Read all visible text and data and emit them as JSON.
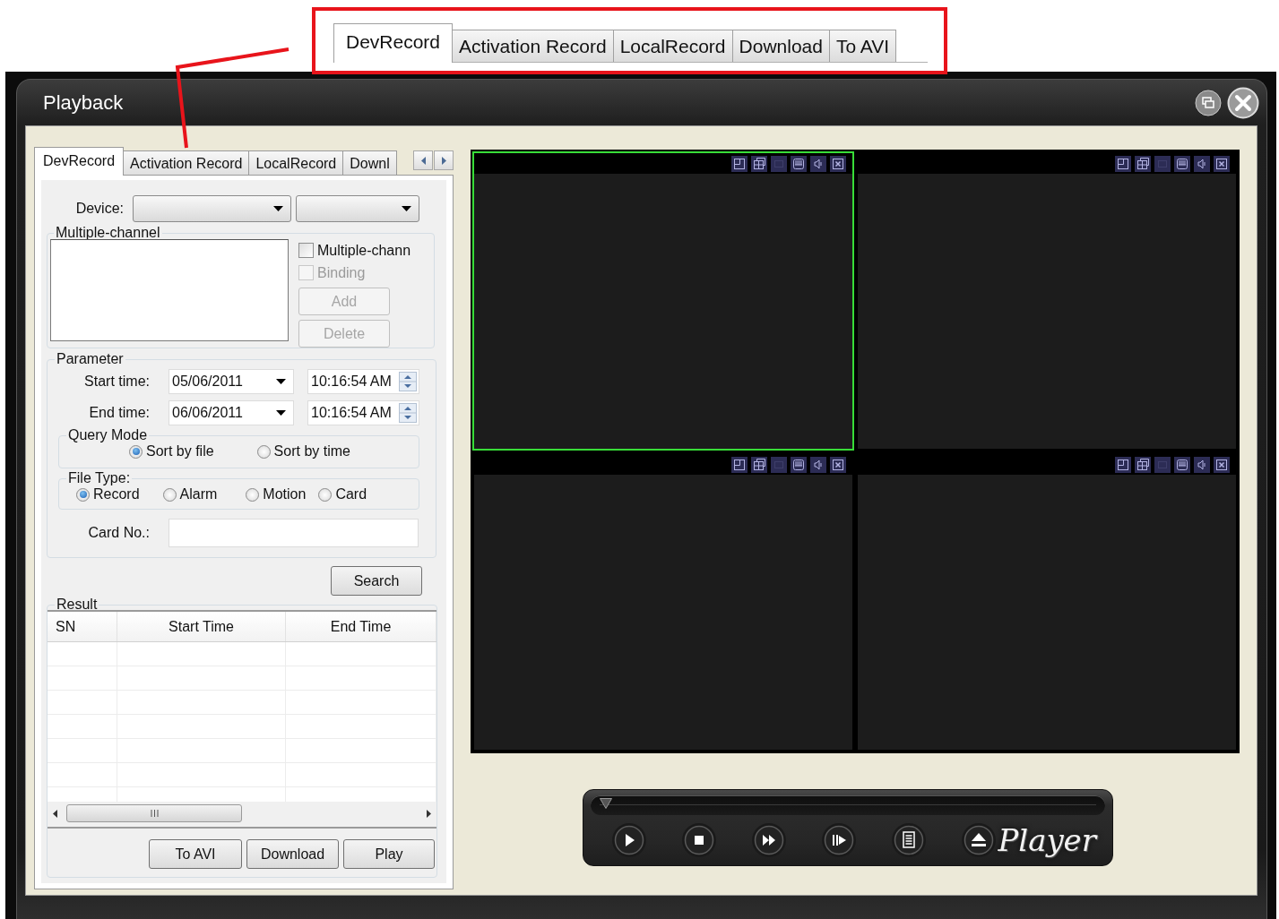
{
  "callout": {
    "tabs": [
      {
        "label": "DevRecord",
        "selected": true
      },
      {
        "label": "Activation Record",
        "selected": false
      },
      {
        "label": "LocalRecord",
        "selected": false
      },
      {
        "label": "Download",
        "selected": false
      },
      {
        "label": "To AVI",
        "selected": false
      }
    ]
  },
  "window": {
    "title": "Playback"
  },
  "search_panel": {
    "tabs": [
      {
        "label": "DevRecord",
        "selected": true
      },
      {
        "label": "Activation Record",
        "selected": false
      },
      {
        "label": "LocalRecord",
        "selected": false
      },
      {
        "label": "Downl",
        "selected": false
      }
    ],
    "device": {
      "label": "Device:"
    },
    "multiple_channel": {
      "title": "Multiple-channel",
      "checkboxes": [
        {
          "label": "Multiple-chann",
          "checked": false,
          "disabled": false
        },
        {
          "label": "Binding",
          "checked": false,
          "disabled": true
        }
      ],
      "buttons": [
        {
          "label": "Add",
          "disabled": true
        },
        {
          "label": "Delete",
          "disabled": true
        }
      ]
    },
    "parameter": {
      "title": "Parameter",
      "rows": [
        {
          "label": "Start time:",
          "date": "05/06/2011",
          "time": "10:16:54 AM"
        },
        {
          "label": "End time:",
          "date": "06/06/2011",
          "time": "10:16:54 AM"
        }
      ],
      "query_mode": {
        "title": "Query Mode",
        "options": [
          {
            "label": "Sort by file",
            "selected": true
          },
          {
            "label": "Sort by time",
            "selected": false
          }
        ]
      },
      "file_type": {
        "title": "File Type:",
        "options": [
          {
            "label": "Record",
            "selected": true
          },
          {
            "label": "Alarm",
            "selected": false
          },
          {
            "label": "Motion",
            "selected": false
          },
          {
            "label": "Card",
            "selected": false
          }
        ]
      },
      "card_no": {
        "label": "Card No.:"
      }
    },
    "search_button": "Search",
    "result": {
      "title": "Result",
      "columns": [
        "SN",
        "Start Time",
        "End Time"
      ]
    },
    "buttons": [
      "To AVI",
      "Download",
      "Play"
    ]
  },
  "video_panes": [
    {
      "selected": true
    },
    {
      "selected": false
    },
    {
      "selected": false
    },
    {
      "selected": false
    }
  ],
  "player": {
    "level": 0,
    "logo": "Player"
  }
}
